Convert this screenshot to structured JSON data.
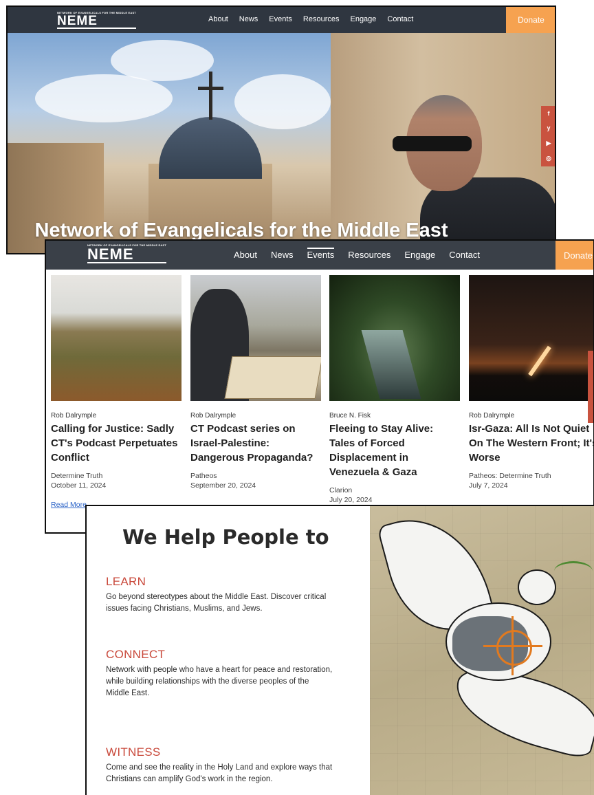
{
  "hero": {
    "logo_tag": "NETWORK OF EVANGELICALS FOR THE MIDDLE EAST",
    "logo": "NEME",
    "menu": [
      "About",
      "News",
      "Events",
      "Resources",
      "Engage",
      "Contact"
    ],
    "donate": "Donate",
    "title": "Network of Evangelicals for the Middle East",
    "social": [
      "f",
      "y",
      "▶",
      "◎"
    ]
  },
  "news": {
    "logo_tag": "NETWORK OF EVANGELICALS FOR THE MIDDLE EAST",
    "logo": "NEME",
    "menu": [
      "About",
      "News",
      "Events",
      "Resources",
      "Engage",
      "Contact"
    ],
    "donate": "Donate",
    "cards": [
      {
        "author": "Rob Dalrymple",
        "title": "Calling for Justice: Sadly CT's Podcast Perpetuates Conflict",
        "source": "Determine Truth",
        "date": "October 11, 2024",
        "more": "Read More"
      },
      {
        "author": "Rob Dalrymple",
        "title": "CT Podcast series on Israel-Palestine: Dangerous Propaganda?",
        "source": "Patheos",
        "date": "September 20, 2024"
      },
      {
        "author": "Bruce N. Fisk",
        "title": "Fleeing to Stay Alive: Tales of Forced Displacement in Venezuela & Gaza",
        "source": "Clarion",
        "date": "July 20, 2024"
      },
      {
        "author": "Rob Dalrymple",
        "title": "Isr-Gaza: All Is Not Quiet On The Western Front; It's Worse",
        "source": "Patheos: Determine Truth",
        "date": "July 7, 2024"
      }
    ]
  },
  "help": {
    "title": "We Help People to",
    "sections": [
      {
        "heading": "LEARN",
        "text": "Go beyond stereotypes about the Middle East. Discover critical issues facing Christians, Muslims, and Jews."
      },
      {
        "heading": "CONNECT",
        "text": "Network with people who have a heart for peace and restoration, while building relationships with the diverse peoples of the Middle East."
      },
      {
        "heading": "WITNESS",
        "text": "Come and see the reality in the Holy Land and explore ways that Christians can amplify God's work in the region."
      }
    ]
  },
  "colors": {
    "nav": "#2f3640",
    "donate": "#f6a250",
    "accent": "#c9493b",
    "link": "#2b63c7"
  }
}
